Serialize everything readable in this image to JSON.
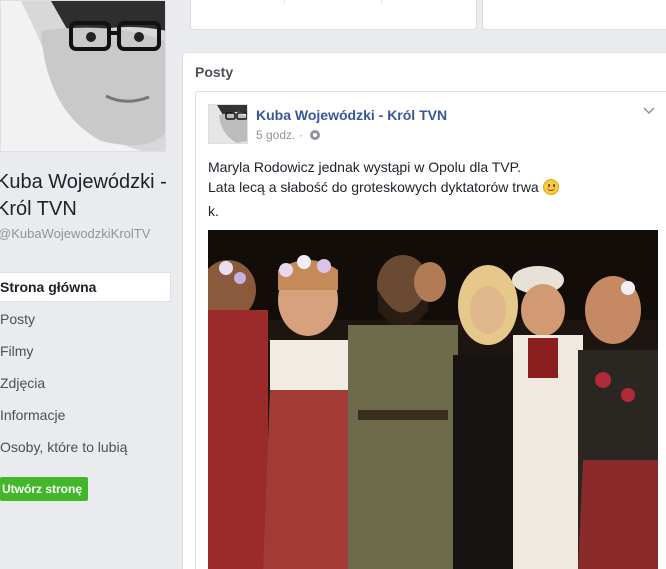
{
  "page": {
    "name": "Kuba Wojewódzki - Król TVN",
    "handle": "@KubaWojewodzkiKrolTV"
  },
  "nav": {
    "items": [
      {
        "label": "Strona główna",
        "active": true
      },
      {
        "label": "Posty"
      },
      {
        "label": "Filmy"
      },
      {
        "label": "Zdjęcia"
      },
      {
        "label": "Informacje"
      },
      {
        "label": "Osoby, które to lubią"
      }
    ],
    "create_page_label": "Utwórz stronę"
  },
  "posts": {
    "heading": "Posty",
    "post": {
      "author": "Kuba Wojewódzki - Król TVN",
      "time": "5 godz.",
      "visibility_icon": "globe-icon",
      "line1": "Maryla Rodowicz jednak wystąpi w Opolu dla TVP.",
      "line2": "Lata lecą a słabość do groteskowych dyktatorów trwa",
      "emoji": "smile-icon",
      "sign": "k."
    }
  },
  "colors": {
    "background": "#e9ebee",
    "link_blue": "#365899",
    "button_green": "#42b72a",
    "muted_text": "#90949c"
  }
}
